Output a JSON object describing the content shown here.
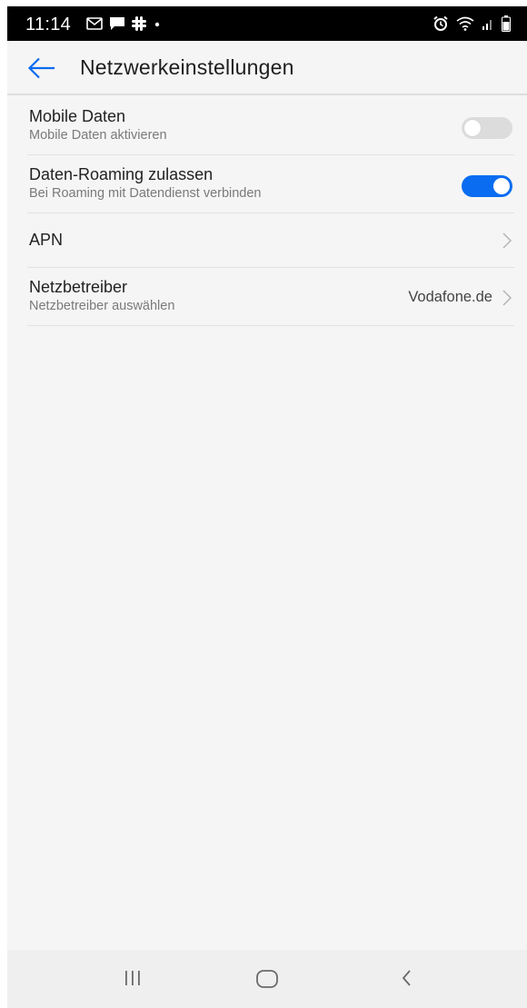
{
  "status_bar": {
    "time": "11:14",
    "left_icons": [
      "gmail-icon",
      "message-icon",
      "slack-icon",
      "dot-icon"
    ],
    "right_icons": [
      "alarm-icon",
      "wifi-icon",
      "signal-icon",
      "battery-icon"
    ]
  },
  "header": {
    "title": "Netzwerkeinstellungen",
    "back_icon": "arrow-left-icon"
  },
  "settings": [
    {
      "title": "Mobile Daten",
      "subtitle": "Mobile Daten aktivieren",
      "control": "toggle",
      "state": "off"
    },
    {
      "title": "Daten-Roaming zulassen",
      "subtitle": "Bei Roaming mit Datendienst verbinden",
      "control": "toggle",
      "state": "on"
    },
    {
      "title": "APN",
      "control": "chevron"
    },
    {
      "title": "Netzbetreiber",
      "subtitle": "Netzbetreiber auswählen",
      "value": "Vodafone.de",
      "control": "chevron"
    }
  ],
  "nav_bar": {
    "buttons": [
      "recents-icon",
      "home-icon",
      "back-icon"
    ]
  },
  "colors": {
    "accent": "#0a6cf0",
    "background": "#f5f5f5",
    "status_bar": "#000000",
    "toggle_off": "#dcdcdc"
  }
}
